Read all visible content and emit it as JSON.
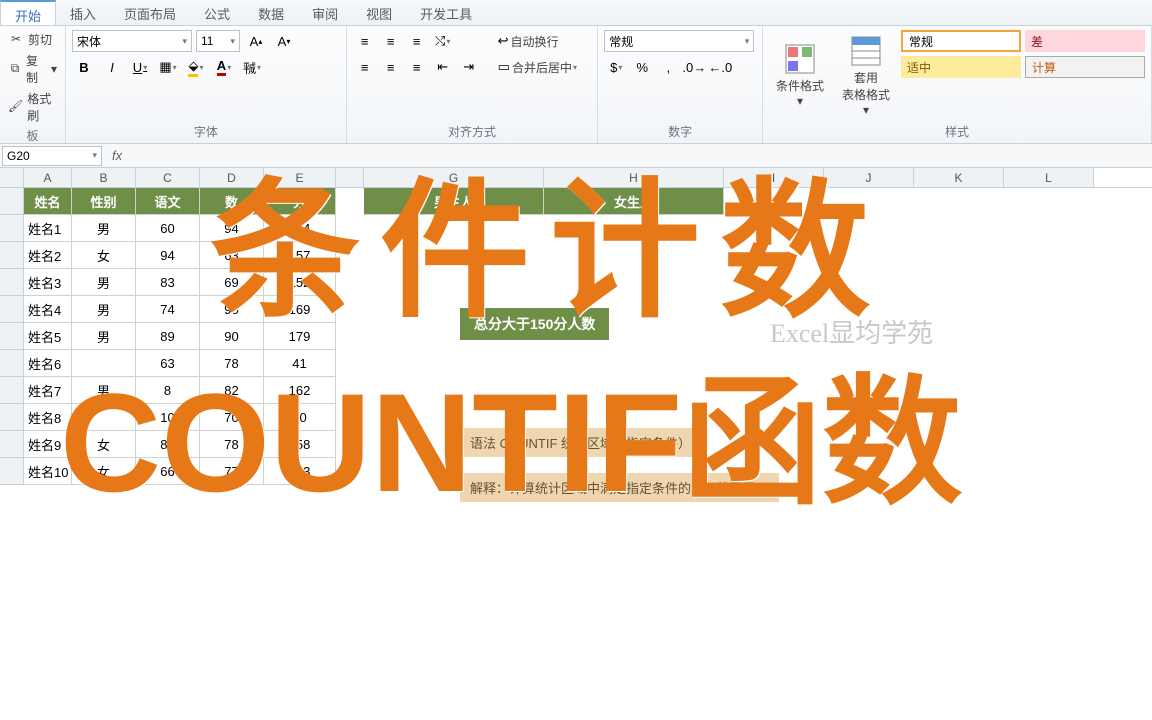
{
  "tabs": [
    "开始",
    "插入",
    "页面布局",
    "公式",
    "数据",
    "审阅",
    "视图",
    "开发工具"
  ],
  "active_tab": 0,
  "clipboard": {
    "cut": "剪切",
    "copy": "复制",
    "format": "格式刷",
    "group": "板"
  },
  "font": {
    "name": "宋体",
    "size": "11",
    "group": "字体",
    "bold": "B",
    "italic": "I",
    "underline": "U"
  },
  "align": {
    "wrap": "自动换行",
    "merge": "合并后居中",
    "group": "对齐方式"
  },
  "number": {
    "format": "常规",
    "group": "数字"
  },
  "cond": {
    "label": "条件格式"
  },
  "tblfmt": {
    "label1": "套用",
    "label2": "表格格式"
  },
  "styles": {
    "normal": "常规",
    "bad": "差",
    "neutral": "适中",
    "calc": "计算",
    "group": "样式"
  },
  "namebox": "G20",
  "cols": [
    "A",
    "B",
    "C",
    "D",
    "E",
    "",
    "G",
    "H",
    "I",
    "J",
    "K",
    "L"
  ],
  "headers": {
    "A": "姓名",
    "B": "性别",
    "C": "语文",
    "D": "数",
    "E": "分",
    "G": "男生人",
    "H": "女生人"
  },
  "rows": [
    {
      "A": "姓名1",
      "B": "男",
      "C": "60",
      "D": "94",
      "E": "154"
    },
    {
      "A": "姓名2",
      "B": "女",
      "C": "94",
      "D": "63",
      "E": "157"
    },
    {
      "A": "姓名3",
      "B": "男",
      "C": "83",
      "D": "69",
      "E": "152"
    },
    {
      "A": "姓名4",
      "B": "男",
      "C": "74",
      "D": "95",
      "E": "169"
    },
    {
      "A": "姓名5",
      "B": "男",
      "C": "89",
      "D": "90",
      "E": "179"
    },
    {
      "A": "姓名6",
      "B": "",
      "C": "63",
      "D": "78",
      "E": "41"
    },
    {
      "A": "姓名7",
      "B": "男",
      "C": "8",
      "D": "82",
      "E": "162"
    },
    {
      "A": "姓名8",
      "B": "",
      "C": "10",
      "D": "70",
      "E": "70"
    },
    {
      "A": "姓名9",
      "B": "女",
      "C": "80",
      "D": "78",
      "E": "158"
    },
    {
      "A": "姓名10",
      "B": "女",
      "C": "66",
      "D": "77",
      "E": "143"
    }
  ],
  "badge_total": "总分大于150分人数",
  "badge_syntax": "语法  COUNTIF  统计区域，指定条件）",
  "badge_explain": "解释：计算统计区域中满足指定条件的单元格数量。",
  "watermark": "Excel显均学苑",
  "overlay1": "条件计数",
  "overlay2a": "COUNTIF",
  "overlay2b": "函数"
}
